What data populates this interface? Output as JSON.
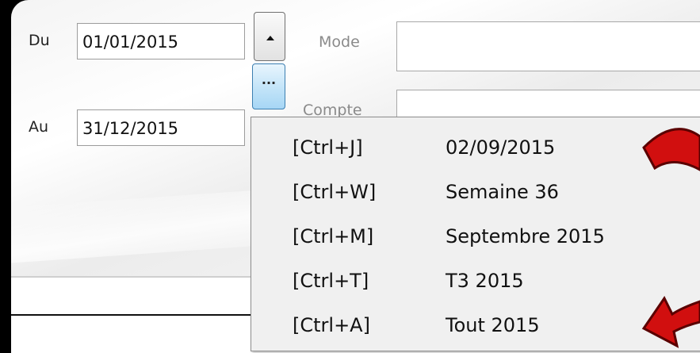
{
  "filters": {
    "from_label": "Du",
    "from_value": "01/01/2015",
    "to_label": "Au",
    "to_value": "31/12/2015",
    "mode_label": "Mode",
    "mode_value": "",
    "account_label": "Compte",
    "account_value": "",
    "ellipsis_label": "..."
  },
  "period_menu": {
    "items": [
      {
        "shortcut": "[Ctrl+J]",
        "label": "02/09/2015"
      },
      {
        "shortcut": "[Ctrl+W]",
        "label": "Semaine 36"
      },
      {
        "shortcut": "[Ctrl+M]",
        "label": "Septembre 2015"
      },
      {
        "shortcut": "[Ctrl+T]",
        "label": "T3 2015"
      },
      {
        "shortcut": "[Ctrl+A]",
        "label": "Tout 2015"
      }
    ]
  },
  "colors": {
    "arrow": "#d10f0f",
    "arrow_outline": "#5a0000",
    "button_hover": "#bfe2f8",
    "menu_bg": "#f0f0f0"
  },
  "icons": {
    "spin_up": "triangle-up-icon",
    "arrow_top": "curved-arrow-icon",
    "arrow_bottom": "pointing-arrow-icon"
  }
}
